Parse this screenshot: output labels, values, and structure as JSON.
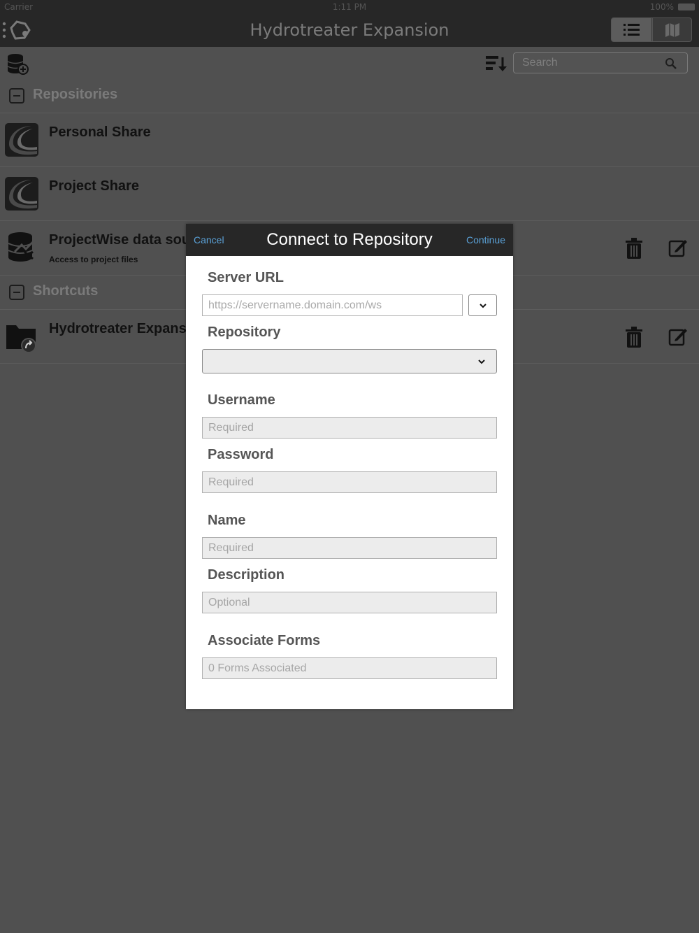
{
  "status_bar": {
    "carrier": "Carrier",
    "time": "1:11 PM",
    "battery": "100%"
  },
  "nav": {
    "title": "Hydrotreater Expansion"
  },
  "toolbar": {
    "search_placeholder": "Search"
  },
  "sections": {
    "repositories": {
      "label": "Repositories",
      "items": [
        {
          "name": "Personal Share"
        },
        {
          "name": "Project Share"
        },
        {
          "name": "ProjectWise data sou",
          "subtitle": "Access to project files"
        }
      ]
    },
    "shortcuts": {
      "label": "Shortcuts",
      "items": [
        {
          "name": "Hydrotreater Expans"
        }
      ]
    }
  },
  "modal": {
    "cancel": "Cancel",
    "title": "Connect to Repository",
    "continue": "Continue",
    "server_url_label": "Server URL",
    "server_url_placeholder": "https://servername.domain.com/ws",
    "repository_label": "Repository",
    "username_label": "Username",
    "username_placeholder": "Required",
    "password_label": "Password",
    "password_placeholder": "Required",
    "name_label": "Name",
    "name_placeholder": "Required",
    "description_label": "Description",
    "description_placeholder": "Optional",
    "forms_label": "Associate Forms",
    "forms_placeholder": "0 Forms Associated"
  }
}
